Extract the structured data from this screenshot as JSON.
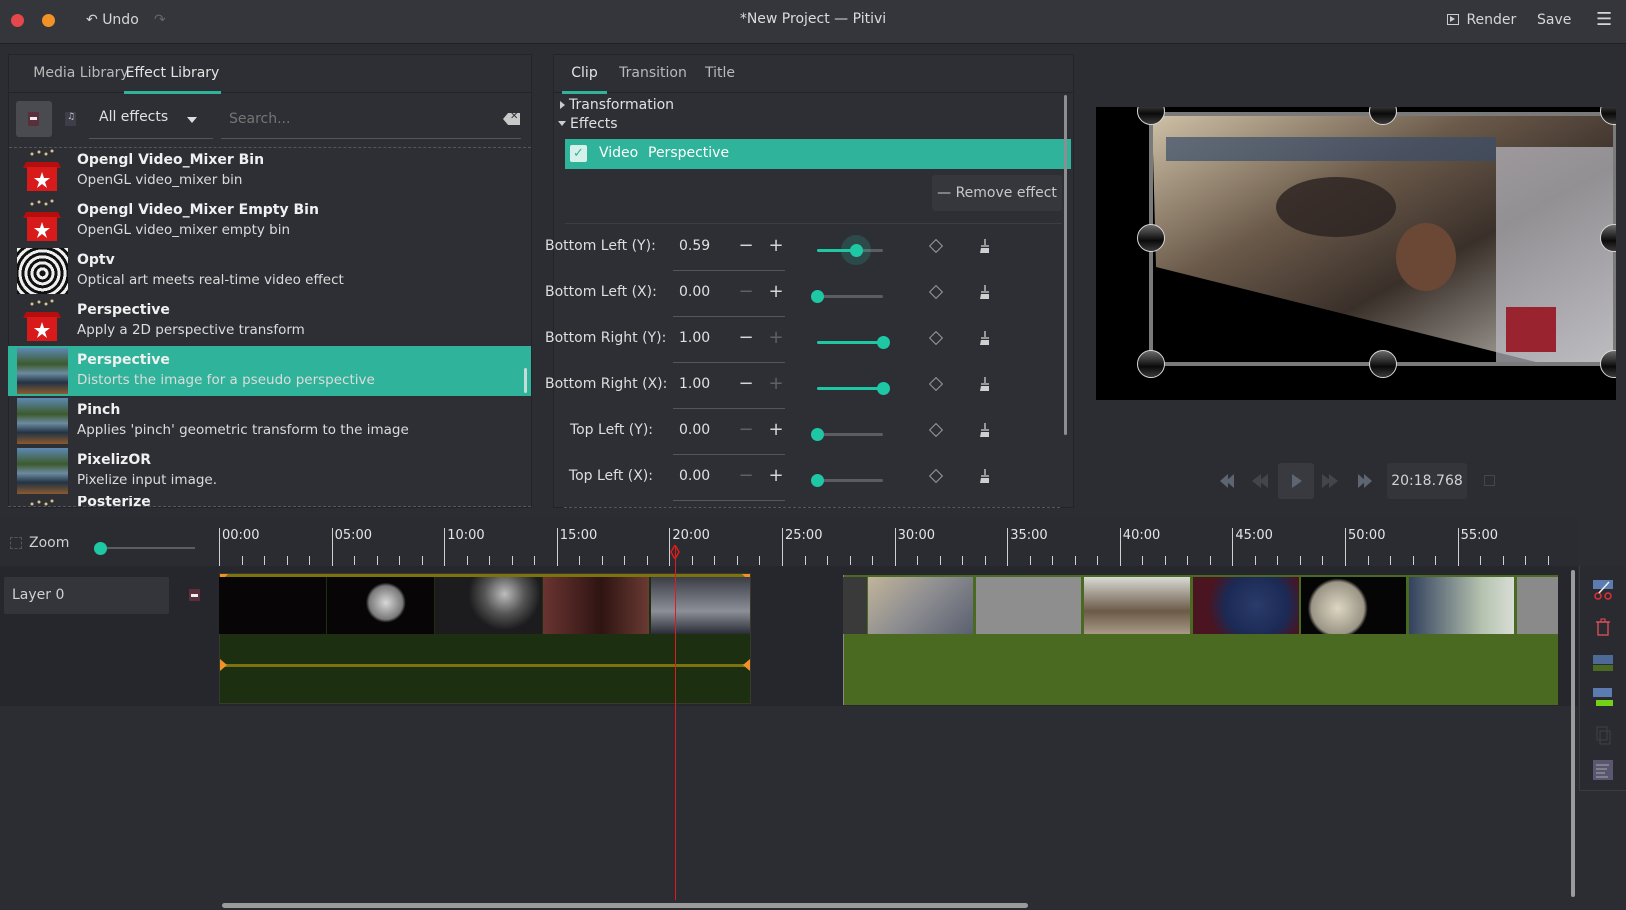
{
  "header": {
    "title": "*New Project — Pitivi",
    "undo_label": "Undo",
    "undo_icon": "undo-arrow-icon",
    "redo_icon": "redo-arrow-icon",
    "render_label": "Render",
    "save_label": "Save",
    "menu_icon": "hamburger-menu-icon",
    "close_color": "#e5474b",
    "minimize_color": "#f29226"
  },
  "library": {
    "tabs": [
      {
        "label": "Media Library",
        "active": false
      },
      {
        "label": "Effect Library",
        "active": true
      }
    ],
    "filter_selected": "All effects",
    "search_placeholder": "Search...",
    "effects": [
      {
        "name": "Opengl Video_Mixer Bin",
        "description": "OpenGL video_mixer bin",
        "icon": "gift-box-icon",
        "selected": false
      },
      {
        "name": "Opengl Video_Mixer Empty Bin",
        "description": "OpenGL video_mixer empty bin",
        "icon": "gift-box-icon",
        "selected": false
      },
      {
        "name": "Optv",
        "description": "Optical art meets real-time video effect",
        "icon": "spiral-thumbnail-icon",
        "selected": false
      },
      {
        "name": "Perspective",
        "description": "Apply a 2D perspective transform",
        "icon": "gift-box-icon",
        "selected": false
      },
      {
        "name": "Perspective",
        "description": "Distorts the image for a pseudo perspective",
        "icon": "lake-thumbnail-icon",
        "selected": true
      },
      {
        "name": "Pinch",
        "description": "Applies 'pinch' geometric transform to the image",
        "icon": "lake-thumbnail-icon",
        "selected": false
      },
      {
        "name": "PixelizOR",
        "description": "Pixelize input image.",
        "icon": "lake-thumbnail-icon",
        "selected": false
      },
      {
        "name": "Posterize",
        "description": "",
        "icon": "gift-box-icon",
        "selected": false
      }
    ]
  },
  "clip": {
    "tabs": [
      {
        "label": "Clip",
        "active": true
      },
      {
        "label": "Transition",
        "active": false
      },
      {
        "label": "Title",
        "active": false
      }
    ],
    "transformation_label": "Transformation",
    "effects_label": "Effects",
    "effect_row": {
      "enabled": true,
      "type": "Video",
      "name": "Perspective"
    },
    "remove_label": "Remove effect",
    "params": [
      {
        "label": "Bottom Left (Y):",
        "value": "0.59",
        "fraction": 0.59,
        "minus_enabled": true,
        "plus_enabled": true,
        "focused": true
      },
      {
        "label": "Bottom Left (X):",
        "value": "0.00",
        "fraction": 0.0,
        "minus_enabled": false,
        "plus_enabled": true,
        "focused": false
      },
      {
        "label": "Bottom Right (Y):",
        "value": "1.00",
        "fraction": 1.0,
        "minus_enabled": true,
        "plus_enabled": false,
        "focused": false
      },
      {
        "label": "Bottom Right (X):",
        "value": "1.00",
        "fraction": 1.0,
        "minus_enabled": true,
        "plus_enabled": false,
        "focused": false
      },
      {
        "label": "Top Left (Y):",
        "value": "0.00",
        "fraction": 0.0,
        "minus_enabled": false,
        "plus_enabled": true,
        "focused": false
      },
      {
        "label": "Top Left (X):",
        "value": "0.00",
        "fraction": 0.0,
        "minus_enabled": false,
        "plus_enabled": true,
        "focused": false
      }
    ]
  },
  "viewer": {
    "timecode": "20:18.768",
    "controls": [
      "go-to-start-icon",
      "seek-backward-icon",
      "play-icon",
      "seek-forward-icon",
      "go-to-end-icon"
    ]
  },
  "timeline": {
    "zoom_label": "Zoom",
    "zoom_fraction": 0.0,
    "layer_label": "Layer 0",
    "ruler_labels": [
      "00:00",
      "05:00",
      "10:00",
      "15:00",
      "20:00",
      "25:00",
      "30:00",
      "35:00",
      "40:00",
      "45:00",
      "50:00",
      "55:00"
    ],
    "playhead_time": "20:18.768",
    "accent_color": "#2fb39a",
    "playhead_color": "#e01b1b",
    "tools": [
      "split-clip-icon",
      "delete-icon",
      "ungroup-icon",
      "group-icon",
      "copy-icon",
      "align-icon"
    ]
  }
}
